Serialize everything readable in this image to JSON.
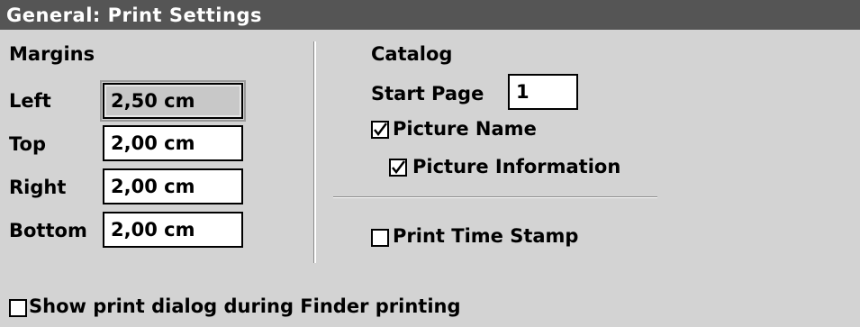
{
  "window": {
    "title": "General: Print Settings"
  },
  "margins": {
    "heading": "Margins",
    "fields": [
      {
        "label": "Left",
        "value": "2,50 cm"
      },
      {
        "label": "Top",
        "value": "2,00 cm"
      },
      {
        "label": "Right",
        "value": "2,00 cm"
      },
      {
        "label": "Bottom",
        "value": "2,00 cm"
      }
    ]
  },
  "catalog": {
    "heading": "Catalog",
    "start_page_label": "Start Page",
    "start_page_value": "1",
    "picture_name": {
      "label": "Picture Name",
      "checked": true
    },
    "picture_information": {
      "label": "Picture Information",
      "checked": true
    }
  },
  "print_time_stamp": {
    "label": "Print Time Stamp",
    "checked": false
  },
  "show_print_dialog": {
    "label": "Show print dialog during Finder printing",
    "checked": false
  }
}
